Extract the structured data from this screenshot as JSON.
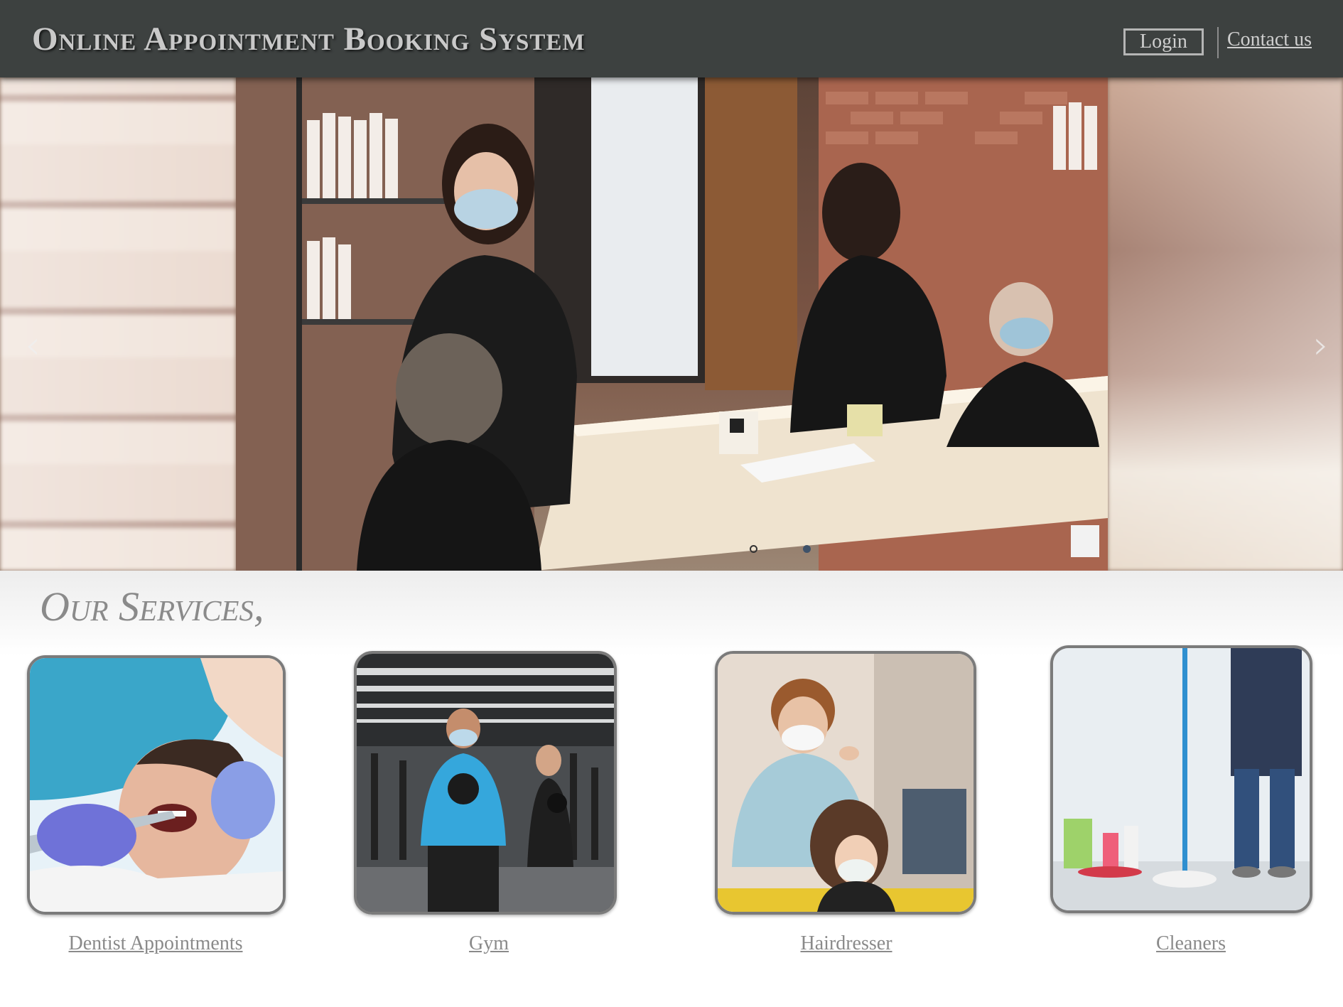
{
  "header": {
    "title": "Online Appointment Booking System",
    "login_label": "Login",
    "contact_label": "Contact us"
  },
  "hero": {
    "prev_icon": "chevron-left-icon",
    "next_icon": "chevron-right-icon",
    "slide_count": 2,
    "active_slide": 2
  },
  "services": {
    "heading": "Our Services,",
    "items": [
      {
        "label": "Dentist Appointments"
      },
      {
        "label": "Gym"
      },
      {
        "label": "Hairdresser"
      },
      {
        "label": "Cleaners"
      }
    ]
  },
  "colors": {
    "header_bg": "#3d4140",
    "header_text": "#c9c9c9",
    "label_text": "#8a8a8a",
    "active_dot": "#3f5269"
  }
}
